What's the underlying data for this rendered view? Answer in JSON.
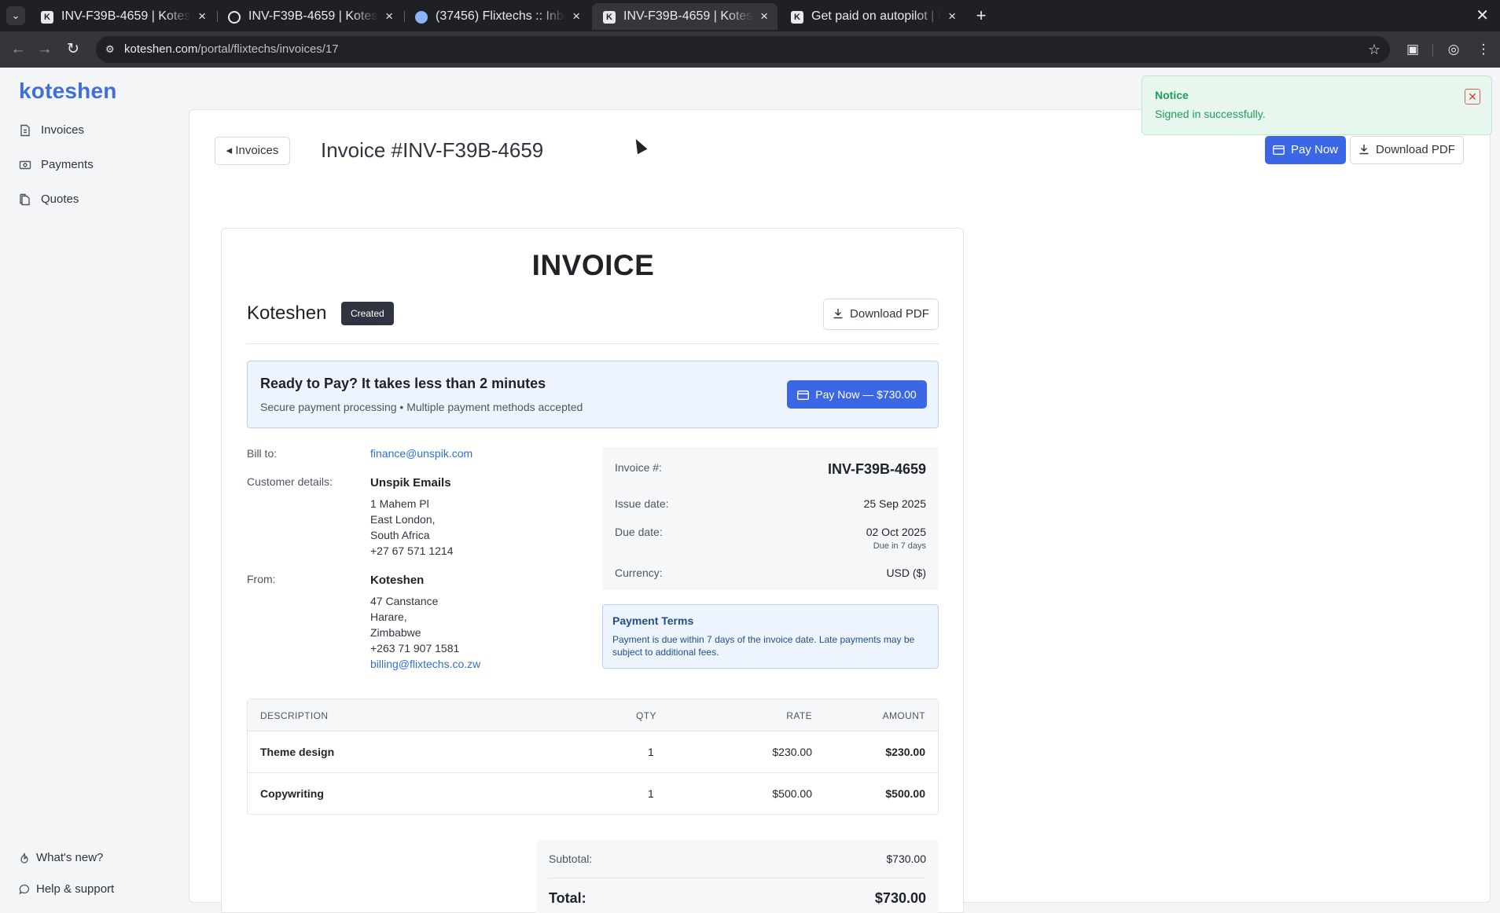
{
  "browser": {
    "tabs": [
      {
        "title": "INV-F39B-4659 | Koteshen",
        "icon": "koteshen-k-icon"
      },
      {
        "title": "INV-F39B-4659 | Koteshen",
        "icon": "globe-icon"
      },
      {
        "title": "(37456) Flixtechs :: Inbox",
        "icon": "mail-ball-icon"
      },
      {
        "title": "INV-F39B-4659 | Koteshen",
        "icon": "koteshen-k-icon",
        "active": true
      },
      {
        "title": "Get paid on autopilot | Koteshen",
        "icon": "koteshen-k-icon"
      }
    ],
    "url_host": "koteshen.com",
    "url_path": "/portal/flixtechs/invoices/17"
  },
  "sidebar": {
    "brand": "koteshen",
    "items": [
      {
        "label": "Invoices",
        "icon": "invoice-icon"
      },
      {
        "label": "Payments",
        "icon": "payments-icon"
      },
      {
        "label": "Quotes",
        "icon": "quotes-icon"
      }
    ],
    "bottom": [
      {
        "label": "What's new?",
        "icon": "flame-icon"
      },
      {
        "label": "Help & support",
        "icon": "chat-bubble-icon"
      }
    ]
  },
  "header": {
    "back_label": "Invoices",
    "title": "Invoice #INV-F39B-4659",
    "pay_now_label": "Pay Now",
    "download_pdf_label": "Download PDF"
  },
  "toast": {
    "title": "Notice",
    "message": "Signed in successfully."
  },
  "invoice": {
    "heading": "INVOICE",
    "company": "Koteshen",
    "status": "Created",
    "download_pdf_label": "Download PDF",
    "pay_banner": {
      "title": "Ready to Pay? It takes less than 2 minutes",
      "subtitle": "Secure payment processing • Multiple payment methods accepted",
      "button": "Pay Now — $730.00"
    },
    "bill_to_label": "Bill to:",
    "bill_to_email": "finance@unspik.com",
    "customer_label": "Customer details:",
    "customer": {
      "name": "Unspik Emails",
      "lines": [
        "1 Mahem Pl",
        "East London,",
        "South Africa",
        "+27 67 571 1214"
      ]
    },
    "from_label": "From:",
    "from": {
      "name": "Koteshen",
      "lines": [
        "47 Canstance",
        "Harare,",
        "Zimbabwe",
        "+263 71 907 1581"
      ],
      "email": "billing@flixtechs.co.zw"
    },
    "meta": {
      "number_label": "Invoice #:",
      "number": "INV-F39B-4659",
      "issue_label": "Issue date:",
      "issue": "25 Sep 2025",
      "due_label": "Due date:",
      "due": "02 Oct 2025",
      "due_note": "Due in 7 days",
      "currency_label": "Currency:",
      "currency": "USD ($)"
    },
    "terms": {
      "title": "Payment Terms",
      "text": "Payment is due within 7 days of the invoice date. Late payments may be subject to additional fees."
    },
    "columns": [
      "DESCRIPTION",
      "QTY",
      "RATE",
      "AMOUNT"
    ],
    "items": [
      {
        "description": "Theme design",
        "qty": "1",
        "rate": "$230.00",
        "amount": "$230.00"
      },
      {
        "description": "Copywriting",
        "qty": "1",
        "rate": "$500.00",
        "amount": "$500.00"
      }
    ],
    "subtotal_label": "Subtotal:",
    "subtotal": "$730.00",
    "total_label": "Total:",
    "total": "$730.00"
  },
  "colors": {
    "brand": "#3f6fd8",
    "primary_button": "#3b66e6",
    "success": "#1e9d5c",
    "badge": "#2e3440"
  }
}
